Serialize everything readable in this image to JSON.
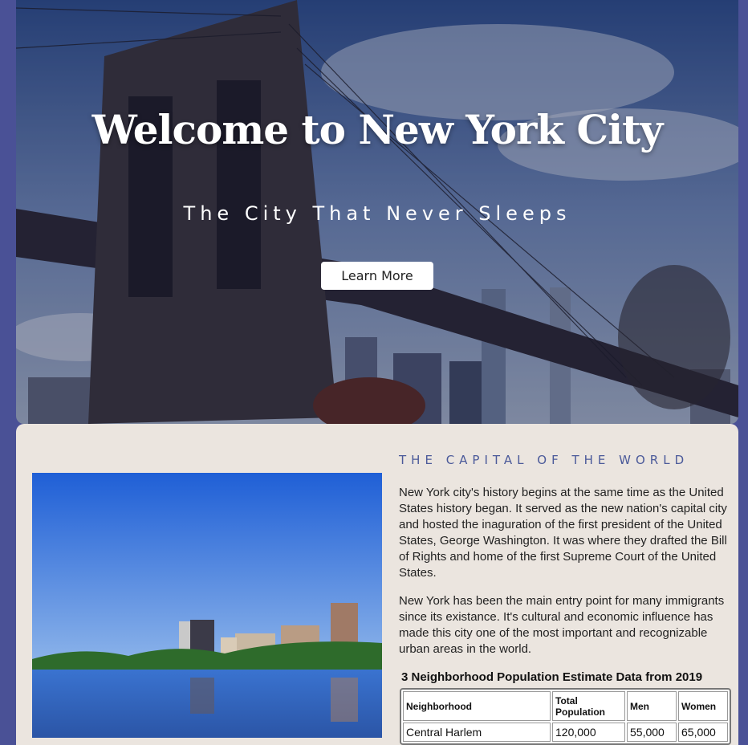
{
  "hero": {
    "title": "Welcome to New York City",
    "subtitle": "The City That Never Sleeps",
    "button_label": "Learn More"
  },
  "about": {
    "heading": "THE CAPITAL OF THE WORLD",
    "paragraphs": [
      "New York city's history begins at the same time as the United States history began. It served as the new nation's capital city and hosted the inaguration of the first president of the United States, George Washington. It was where they drafted the Bill of Rights and home of the first Supreme Court of the United States.",
      "New York has been the main entry point for many immigrants since its existance. It's cultural and economic influence has made this city one of the most important and recognizable urban areas in the world."
    ]
  },
  "population_table": {
    "caption": "3 Neighborhood Population Estimate Data from 2019",
    "headers": [
      "Neighborhood",
      "Total Population",
      "Men",
      "Women"
    ],
    "rows": [
      [
        "Central Harlem",
        "120,000",
        "55,000",
        "65,000"
      ]
    ]
  },
  "colors": {
    "page_background": "#4a5196",
    "content_background": "#ebe5df",
    "heading_accent": "#4b5a9a"
  }
}
